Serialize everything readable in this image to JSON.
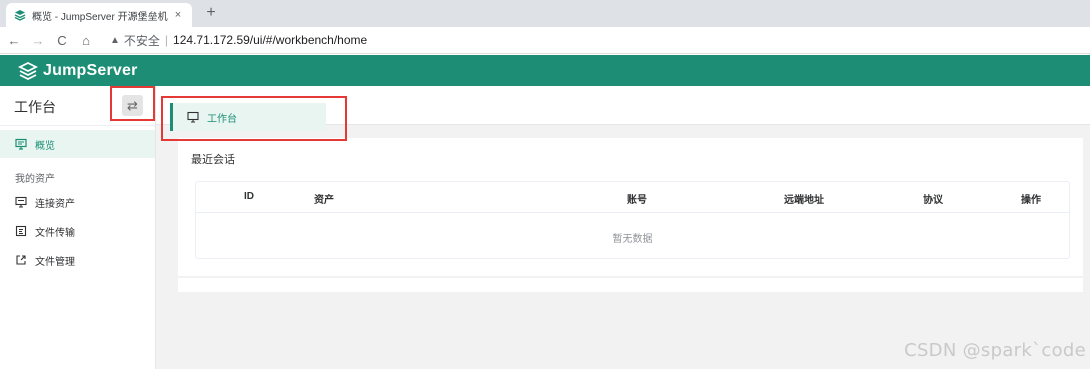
{
  "browser": {
    "tab_title": "概览 - JumpServer 开源堡垒机",
    "tab_close": "×",
    "new_tab": "+",
    "nav": {
      "back": "←",
      "forward": "→",
      "reload": "C",
      "home": "⌂"
    },
    "security_icon": "▲",
    "security_text": "不安全",
    "separator": "|",
    "url": "124.71.172.59/ui/#/workbench/home"
  },
  "app": {
    "brand": "JumpServer",
    "brand_color": "#1d8e75",
    "accent_light": "#e8f5f1",
    "annotation_color": "#e53935"
  },
  "sidebar": {
    "title": "工作台",
    "switch_icon": "⇄",
    "items": [
      {
        "label": "概览",
        "icon": "monitor-icon",
        "active": true
      },
      {
        "group": "我的资产"
      },
      {
        "label": "连接资产",
        "icon": "desktop-icon"
      },
      {
        "label": "文件传输",
        "icon": "file-transfer-icon"
      },
      {
        "label": "文件管理",
        "icon": "external-link-icon"
      }
    ]
  },
  "main": {
    "tab": {
      "label": "工作台",
      "icon": "monitor-icon"
    },
    "card_title": "最近会话",
    "table": {
      "columns": [
        "ID",
        "资产",
        "账号",
        "远端地址",
        "协议",
        "操作"
      ],
      "empty_text": "暂无数据"
    }
  },
  "watermark": "CSDN @spark`code"
}
